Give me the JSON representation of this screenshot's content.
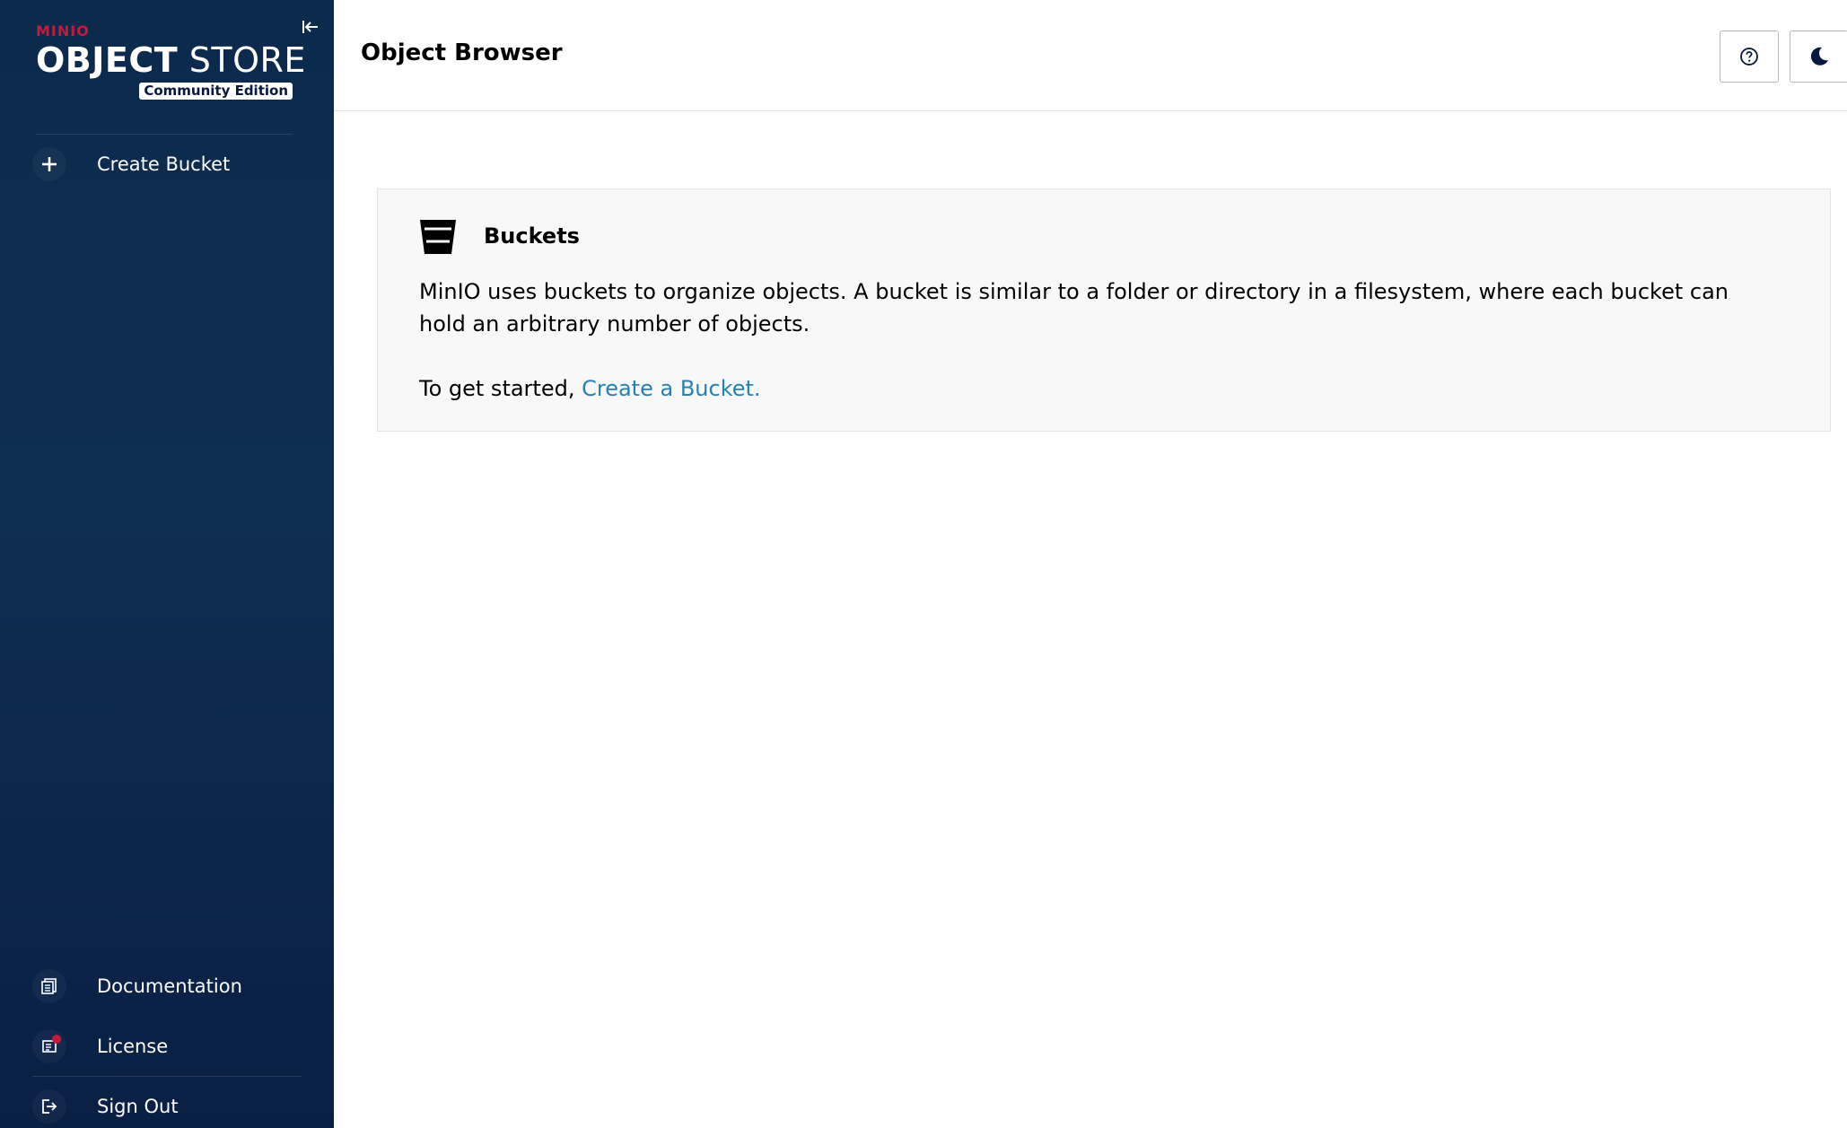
{
  "sidebar": {
    "logo": {
      "brand": "MINIO",
      "title_bold": "OBJECT",
      "title_light": "STORE",
      "edition": "Community Edition"
    },
    "collapse_icon": "collapse-left-icon",
    "top_items": [
      {
        "label": "Create Bucket",
        "icon": "plus-icon"
      }
    ],
    "bottom_items": [
      {
        "label": "Documentation",
        "icon": "document-icon"
      },
      {
        "label": "License",
        "icon": "license-icon",
        "has_notification": true
      },
      {
        "label": "Sign Out",
        "icon": "logout-icon"
      }
    ]
  },
  "header": {
    "title": "Object Browser",
    "help_icon": "help-icon",
    "theme_icon": "moon-icon"
  },
  "main": {
    "card": {
      "icon": "bucket-icon",
      "title": "Buckets",
      "description": "MinIO uses buckets to organize objects. A bucket is similar to a folder or directory in a filesystem, where each bucket can hold an arbitrary number of objects.",
      "cta_prefix": "To get started,",
      "cta_link": "Create a Bucket."
    }
  },
  "colors": {
    "sidebar_bg": "#0c2a4c",
    "brand_red": "#c51b3a",
    "link_blue": "#2781b0"
  }
}
